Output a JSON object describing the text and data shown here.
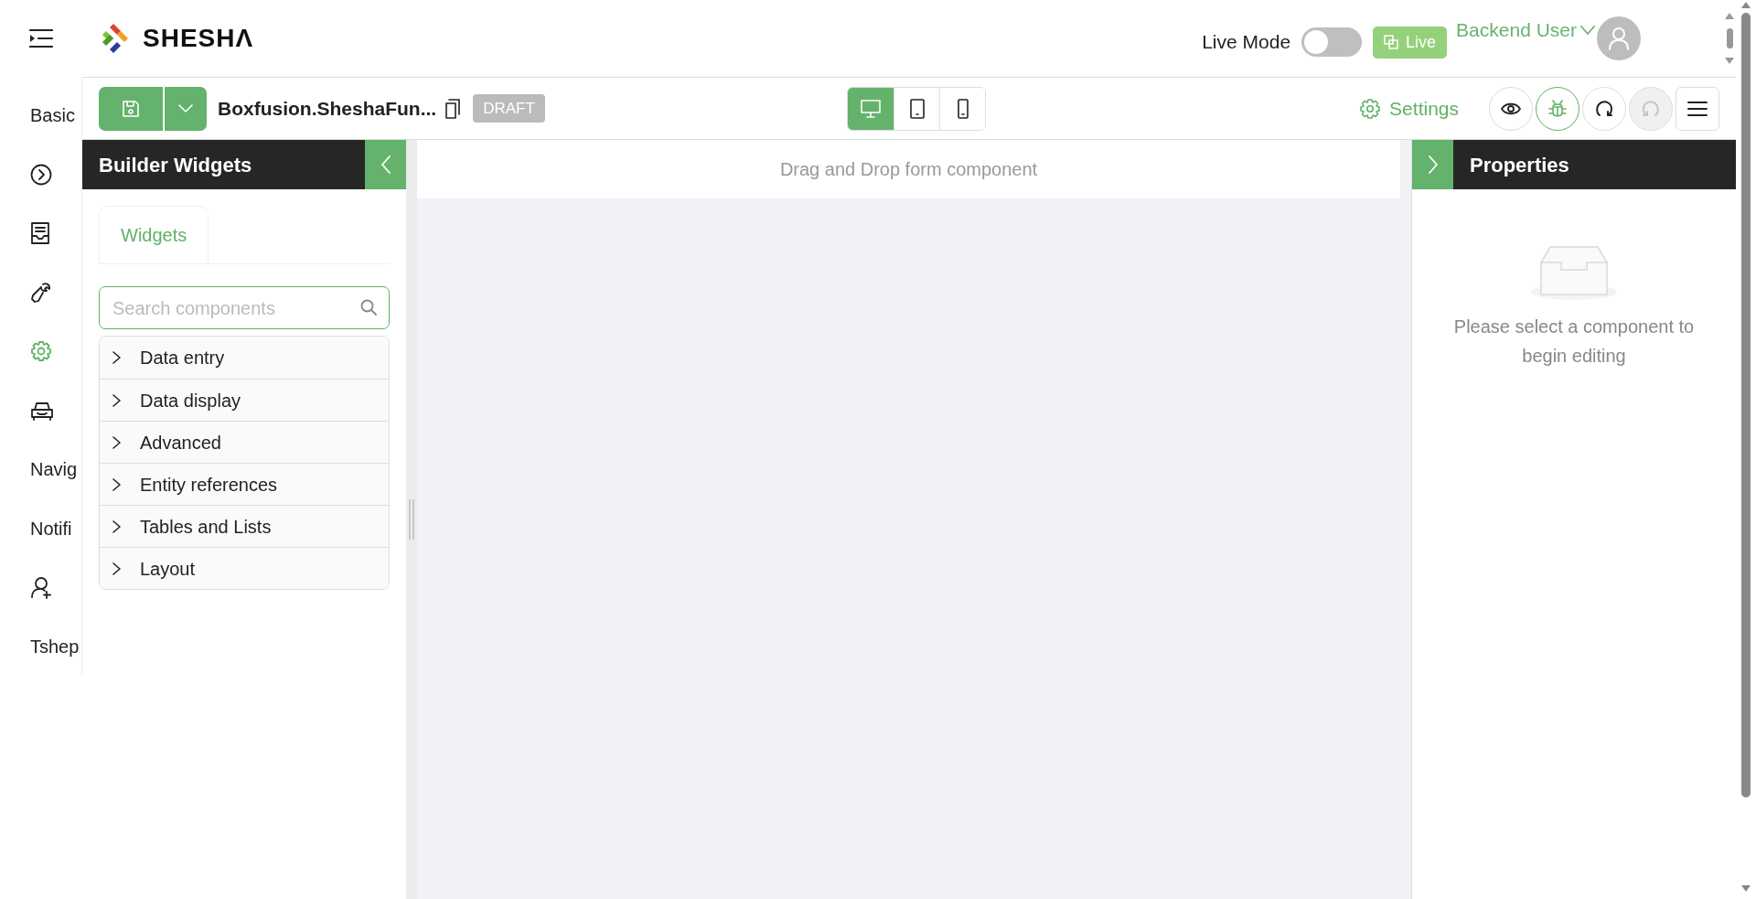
{
  "app": {
    "name": "SHESHΛ"
  },
  "header": {
    "live_mode": {
      "label": "Live Mode",
      "on": false
    },
    "live_badge": "Live",
    "user": {
      "name": "Backend User"
    }
  },
  "sidebar": {
    "items": [
      {
        "kind": "text",
        "label": "Basic",
        "selected": false
      },
      {
        "kind": "icon",
        "selected": false
      },
      {
        "kind": "icon",
        "selected": false
      },
      {
        "kind": "icon",
        "selected": false
      },
      {
        "kind": "icon",
        "selected": true
      },
      {
        "kind": "icon",
        "selected": false
      },
      {
        "kind": "text",
        "label": "Navig",
        "selected": false
      },
      {
        "kind": "text",
        "label": "Notifi",
        "selected": false
      },
      {
        "kind": "icon",
        "selected": false
      },
      {
        "kind": "text",
        "label": "Tshep",
        "selected": false
      }
    ]
  },
  "toolbar": {
    "form_name": "Boxfusion.SheshaFun...",
    "status": "DRAFT",
    "devices": [
      {
        "selected": true
      },
      {
        "selected": false
      },
      {
        "selected": false
      }
    ],
    "settings": "Settings",
    "actions": [
      {
        "disabled": false
      },
      {
        "disabled": false
      },
      {
        "disabled": false
      },
      {
        "disabled": true
      },
      {
        "disabled": false
      }
    ]
  },
  "left_panel": {
    "title": "Builder Widgets",
    "tabs": [
      {
        "label": "Widgets",
        "selected": true
      }
    ],
    "search": {
      "placeholder": "Search components"
    },
    "groups": [
      {
        "label": "Data entry",
        "expanded": false
      },
      {
        "label": "Data display",
        "expanded": false
      },
      {
        "label": "Advanced",
        "expanded": false
      },
      {
        "label": "Entity references",
        "expanded": false
      },
      {
        "label": "Tables and Lists",
        "expanded": false
      },
      {
        "label": "Layout",
        "expanded": false
      }
    ]
  },
  "canvas": {
    "hint": "Drag and Drop form component"
  },
  "right_panel": {
    "title": "Properties",
    "empty_text": "Please select a component to begin editing"
  }
}
